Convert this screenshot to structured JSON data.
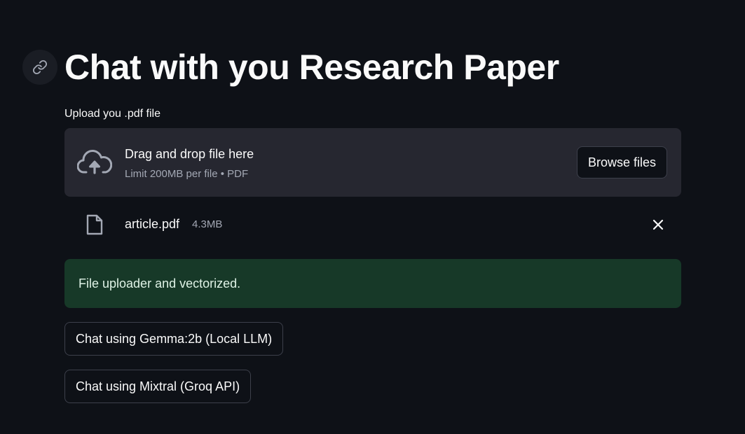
{
  "page": {
    "title": "Chat with you Research Paper"
  },
  "uploader": {
    "label": "Upload you .pdf file",
    "dropzone_title": "Drag and drop file here",
    "dropzone_subtitle": "Limit 200MB per file • PDF",
    "browse_label": "Browse files",
    "icon": "cloud-upload-icon"
  },
  "uploaded_file": {
    "name": "article.pdf",
    "size": "4.3MB",
    "icon": "file-icon",
    "remove_icon": "close-icon"
  },
  "alert": {
    "type": "success",
    "text": "File uploader and vectorized."
  },
  "actions": {
    "gemma_label": "Chat using Gemma:2b (Local LLM)",
    "mixtral_label": "Chat using Mixtral (Groq API)"
  },
  "colors": {
    "background": "#0e1117",
    "dropzone": "#262730",
    "success_bg": "#173928",
    "success_text": "#dff2e6",
    "muted_text": "#a3a8b4",
    "border": "#3d404b"
  }
}
